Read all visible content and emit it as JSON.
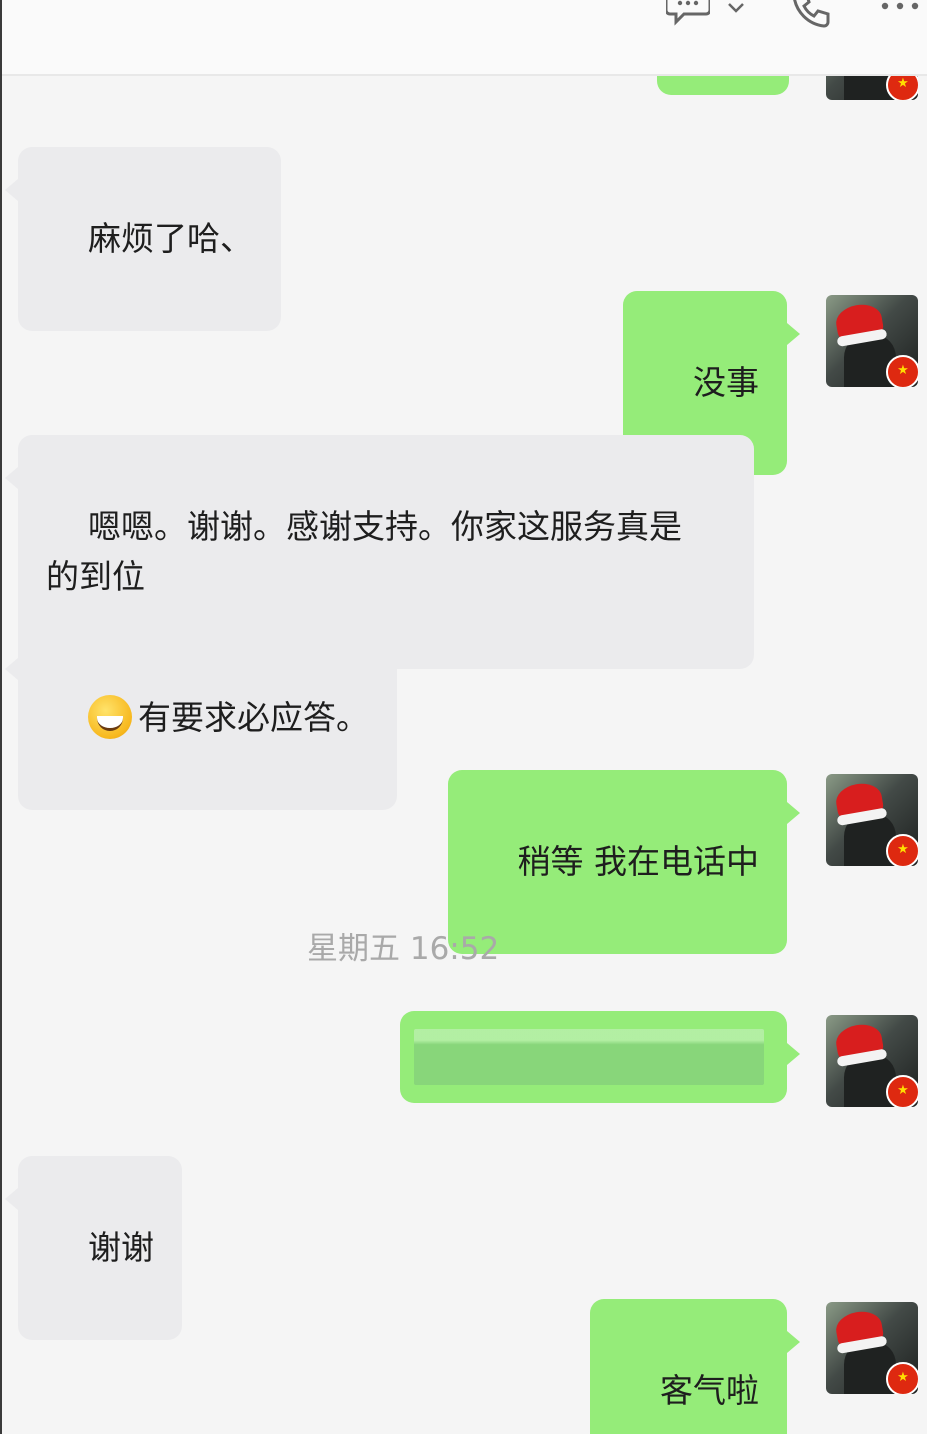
{
  "header": {
    "icons": [
      "chat-bubble-icon",
      "chevron-down-icon",
      "phone-icon",
      "more-icon"
    ]
  },
  "messages": [
    {
      "id": "m1",
      "side": "in",
      "text": "麻烦了哈、"
    },
    {
      "id": "m2",
      "side": "out",
      "text": "没事"
    },
    {
      "id": "m3",
      "side": "in",
      "text": "嗯嗯。谢谢。感谢支持。你家这服务真是\n的到位"
    },
    {
      "id": "m4",
      "side": "in",
      "emoji": "grinning-emoji",
      "text": "有要求必应答。"
    },
    {
      "id": "m5",
      "side": "out",
      "text": "稍等 我在电话中"
    },
    {
      "id": "m6",
      "side": "out",
      "text": "",
      "redacted": true
    },
    {
      "id": "m7",
      "side": "in",
      "text": "谢谢"
    },
    {
      "id": "m8",
      "side": "out",
      "text": "客气啦"
    }
  ],
  "timestamp": "星期五 16:52",
  "colors": {
    "outgoing_bubble": "#95ec79",
    "incoming_bubble": "#ebebed",
    "background": "#f5f5f5"
  }
}
